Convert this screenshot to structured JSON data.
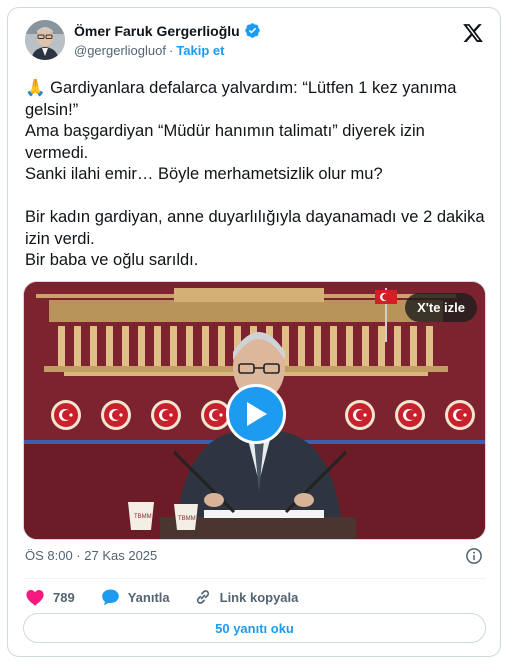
{
  "author": {
    "name": "Ömer Faruk Gergerlioğlu",
    "handle": "@gergerliogluof",
    "separator": "·",
    "follow_label": "Takip et",
    "verified_color": "#1d9bf0"
  },
  "post": {
    "text": "🙏 Gardiyanlara defalarca yalvardım: “Lütfen 1 kez yanıma gelsin!”\nAma başgardiyan “Müdür hanımın talimatı” diyerek izin vermedi.\nSanki ilahi emir… Böyle merhametsizlik olur mu?\n\nBir kadın gardiyan, anne duyarlılığıyla dayanamadı ve 2 dakika izin verdi.\nBir baba ve oğlu sarıldı.",
    "timestamp": "ÖS 8:00 · 27 Kas 2025"
  },
  "media": {
    "watch_label": "X'te izle",
    "cup_label": "TBMM"
  },
  "actions": {
    "like_count": "789",
    "reply_label": "Yanıtla",
    "copy_link_label": "Link kopyala",
    "read_replies_label": "50 yanıtı oku"
  },
  "colors": {
    "accent": "#1d9bf0",
    "like": "#f91880",
    "backdrop": "#7a1f2a",
    "secondary_text": "#536471"
  },
  "icons": [
    "verified-badge-icon",
    "x-logo-icon",
    "play-icon",
    "info-icon",
    "heart-icon",
    "reply-bubble-icon",
    "link-icon"
  ]
}
